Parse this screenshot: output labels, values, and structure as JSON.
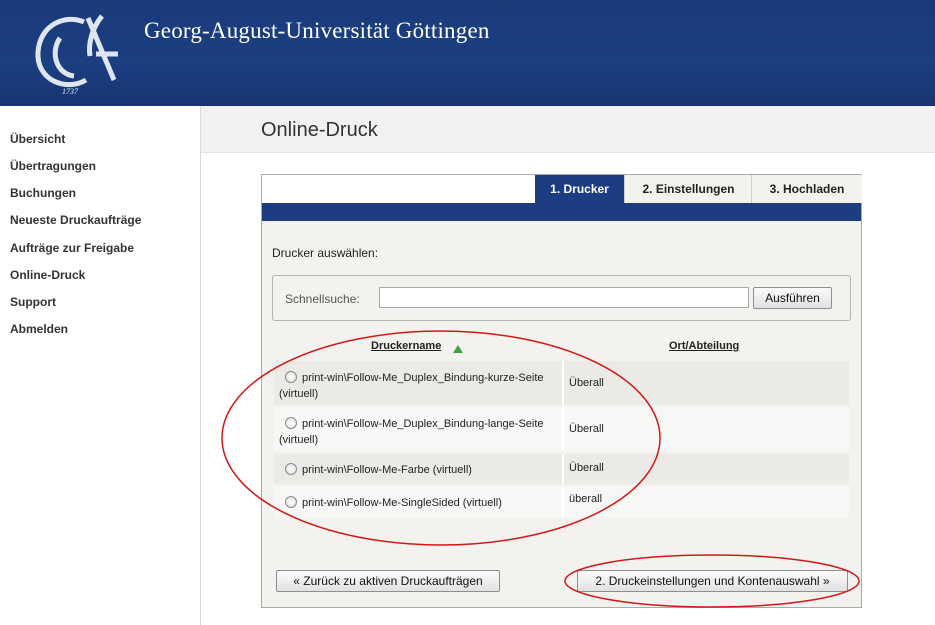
{
  "header": {
    "title": "Georg-August-Universität Göttingen",
    "logo_year": "1737"
  },
  "sidebar": {
    "items": [
      {
        "label": "Übersicht"
      },
      {
        "label": "Übertragungen"
      },
      {
        "label": "Buchungen"
      },
      {
        "label": "Neueste Druckaufträge"
      },
      {
        "label": "Aufträge zur Freigabe"
      },
      {
        "label": "Online-Druck"
      },
      {
        "label": "Support"
      },
      {
        "label": "Abmelden"
      }
    ]
  },
  "main": {
    "title": "Online-Druck",
    "tabs": [
      {
        "label": "1. Drucker",
        "active": true
      },
      {
        "label": "2. Einstellungen",
        "active": false
      },
      {
        "label": "3. Hochladen",
        "active": false
      }
    ],
    "instruction": "Drucker auswählen:",
    "search": {
      "label": "Schnellsuche:",
      "value": "",
      "placeholder": "",
      "button": "Ausführen"
    },
    "table": {
      "columns": [
        "Druckername",
        "Ort/Abteilung"
      ],
      "sorted_column": "Druckername",
      "rows": [
        {
          "name": "print-win\\Follow-Me_Duplex_Bindung-kurze-Seite (virtuell)",
          "location": "Überall"
        },
        {
          "name": "print-win\\Follow-Me_Duplex_Bindung-lange-Seite (virtuell)",
          "location": "Überall"
        },
        {
          "name": "print-win\\Follow-Me-Farbe (virtuell)",
          "location": "Überall"
        },
        {
          "name": "print-win\\Follow-Me-SingleSided (virtuell)",
          "location": "überall"
        }
      ]
    },
    "back_button": "« Zurück zu aktiven Druckaufträgen",
    "next_button": "2. Druckeinstellungen und Kontenauswahl »"
  },
  "colors": {
    "header_blue": "#1c3d82",
    "annotation_red": "#d01818",
    "sort_arrow_green": "#3ea23e"
  }
}
